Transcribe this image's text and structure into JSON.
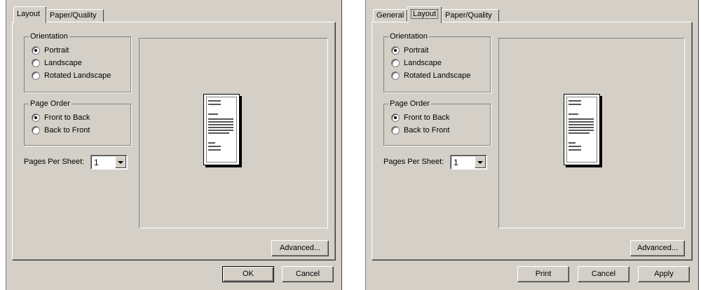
{
  "dialog_left": {
    "tabs": [
      {
        "label": "Layout",
        "active": true
      },
      {
        "label": "Paper/Quality",
        "active": false
      }
    ],
    "orientation": {
      "legend": "Orientation",
      "options": [
        "Portrait",
        "Landscape",
        "Rotated Landscape"
      ],
      "selected": "Portrait"
    },
    "page_order": {
      "legend": "Page Order",
      "options": [
        "Front to Back",
        "Back to Front"
      ],
      "selected": "Front to Back"
    },
    "pages_per_sheet": {
      "label": "Pages Per Sheet:",
      "value": "1"
    },
    "advanced_label": "Advanced...",
    "buttons": {
      "ok": "OK",
      "cancel": "Cancel"
    }
  },
  "dialog_right": {
    "tabs": [
      {
        "label": "General",
        "active": false
      },
      {
        "label": "Layout",
        "active": true
      },
      {
        "label": "Paper/Quality",
        "active": false
      }
    ],
    "orientation": {
      "legend": "Orientation",
      "options": [
        "Portrait",
        "Landscape",
        "Rotated Landscape"
      ],
      "selected": "Portrait"
    },
    "page_order": {
      "legend": "Page Order",
      "options": [
        "Front to Back",
        "Back to Front"
      ],
      "selected": "Front to Back"
    },
    "pages_per_sheet": {
      "label": "Pages Per Sheet:",
      "value": "1"
    },
    "advanced_label": "Advanced...",
    "buttons": {
      "print": "Print",
      "cancel": "Cancel",
      "apply": "Apply"
    }
  }
}
